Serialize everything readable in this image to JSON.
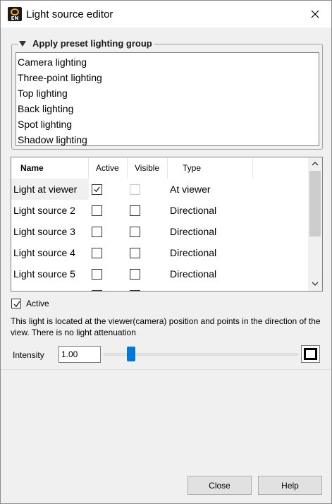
{
  "window": {
    "title": "Light source editor",
    "app_icon": "gear-rings-logo-icon",
    "app_icon_text": "EN",
    "close_icon": "close-icon"
  },
  "preset_group": {
    "header": "Apply preset lighting group",
    "collapse_icon": "triangle-down-icon",
    "items": [
      "Camera lighting",
      "Three-point lighting",
      "Top lighting",
      "Back lighting",
      "Spot lighting",
      "Shadow lighting"
    ]
  },
  "light_table": {
    "columns": [
      "Name",
      "Active",
      "Visible",
      "Type"
    ],
    "rows": [
      {
        "name": "Light at viewer",
        "active": true,
        "visible": false,
        "visible_disabled": true,
        "type": "At viewer"
      },
      {
        "name": "Light source 2",
        "active": false,
        "visible": false,
        "visible_disabled": false,
        "type": "Directional"
      },
      {
        "name": "Light source 3",
        "active": false,
        "visible": false,
        "visible_disabled": false,
        "type": "Directional"
      },
      {
        "name": "Light source 4",
        "active": false,
        "visible": false,
        "visible_disabled": false,
        "type": "Directional"
      },
      {
        "name": "Light source 5",
        "active": false,
        "visible": false,
        "visible_disabled": false,
        "type": "Directional"
      }
    ],
    "selected_row": 0
  },
  "details": {
    "active_label": "Active",
    "active_checked": true,
    "description": "This light is located at the viewer(camera) position and points in the direction of the view.  There is no light attenuation",
    "intensity_label": "Intensity",
    "intensity_value": "1.00",
    "intensity_fraction": 0.14,
    "color": "#ffffff"
  },
  "buttons": {
    "close": "Close",
    "help": "Help"
  },
  "colors": {
    "accent": "#0078d7",
    "panel": "#f0f0f0"
  }
}
